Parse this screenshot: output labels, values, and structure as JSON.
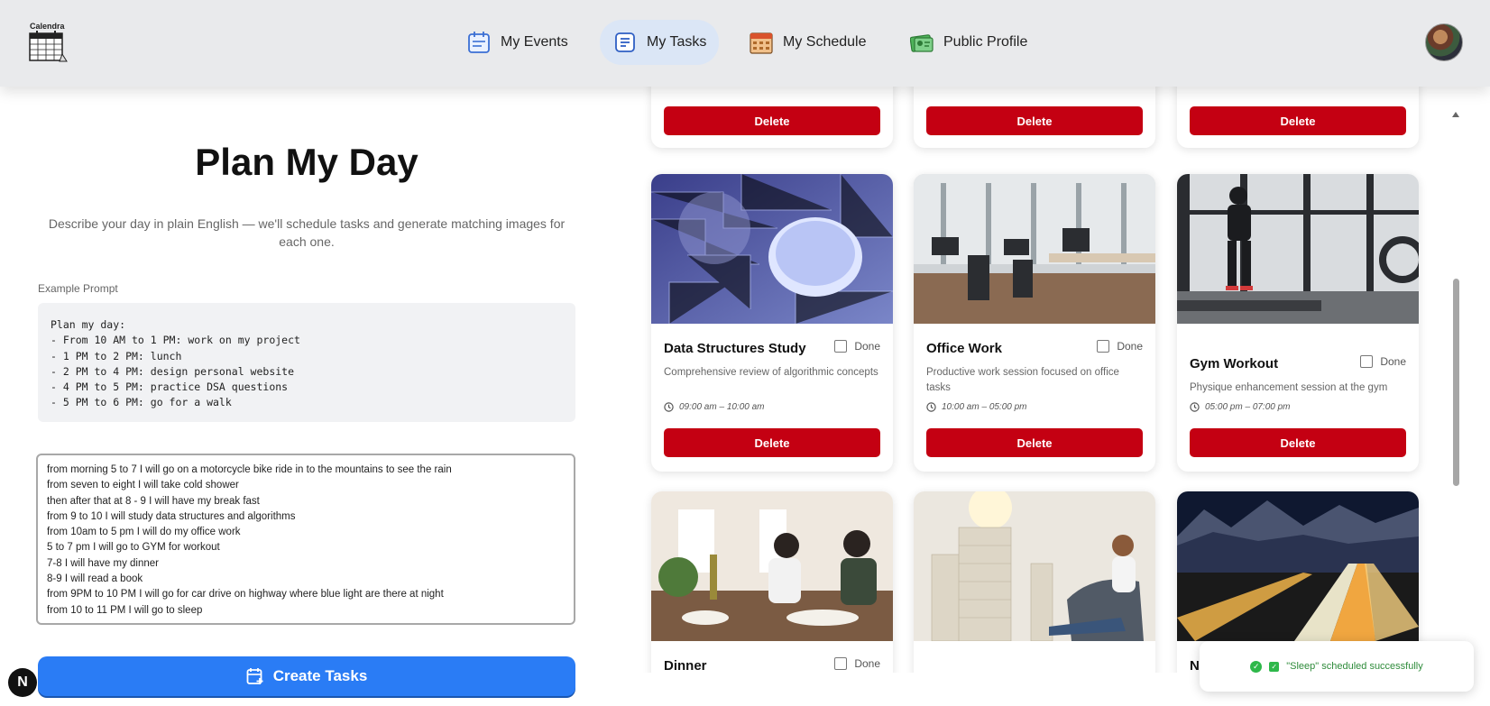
{
  "header": {
    "logo_text": "Calendra",
    "nav": [
      {
        "label": "My Events",
        "icon": "calendar-list-icon"
      },
      {
        "label": "My Tasks",
        "icon": "notes-icon",
        "active": true
      },
      {
        "label": "My Schedule",
        "icon": "schedule-calendar-icon"
      },
      {
        "label": "Public Profile",
        "icon": "profile-card-icon"
      }
    ]
  },
  "planner": {
    "title": "Plan My Day",
    "subtitle": "Describe your day in plain English — we'll schedule tasks and generate matching images for each one.",
    "example_label": "Example Prompt",
    "example_lines": [
      "Plan my day:",
      "- From 10 AM to 1 PM: work on my project",
      "- 1 PM to 2 PM: lunch",
      "- 2 PM to 4 PM: design personal website",
      "- 4 PM to 5 PM: practice DSA questions",
      "- 5 PM to 6 PM: go for a walk"
    ],
    "input_lines": [
      "from morning 5 to 7 I will go on a motorcycle bike ride in to the mountains to see the rain",
      "from seven to eight I will take cold shower",
      "then after that at 8 - 9 I will have my break fast",
      "from 9 to 10 I will study data structures and algorithms",
      "from 10am to 5 pm I will do my office work",
      "5 to 7 pm I will go to GYM for workout",
      "7-8 I will have my dinner",
      "8-9 I will read a book",
      "from 9PM to 10 PM I will go for car drive on highway where blue light are there at night",
      "from 10 to 11 PM I will go to sleep"
    ],
    "create_button": "Create Tasks"
  },
  "tasks": {
    "delete_label": "Delete",
    "done_label": "Done",
    "cards": [
      {
        "title": "Data Structures Study",
        "description": "Comprehensive review of algorithmic concepts",
        "time": "09:00 am – 10:00 am",
        "image": "circuit-chip-image"
      },
      {
        "title": "Office Work",
        "description": "Productive work session focused on office tasks",
        "time": "10:00 am – 05:00 pm",
        "image": "office-room-image"
      },
      {
        "title": "Gym Workout",
        "description": "Physique enhancement session at the gym",
        "time": "05:00 pm – 07:00 pm",
        "image": "gym-image"
      },
      {
        "title": "Dinner",
        "image": "dinner-table-image"
      },
      {
        "title": "",
        "image": "reading-books-image"
      },
      {
        "title": "N",
        "image": "night-highway-image"
      }
    ]
  },
  "toast": {
    "message": "\"Sleep\" scheduled successfully"
  },
  "dev_badge": "N"
}
